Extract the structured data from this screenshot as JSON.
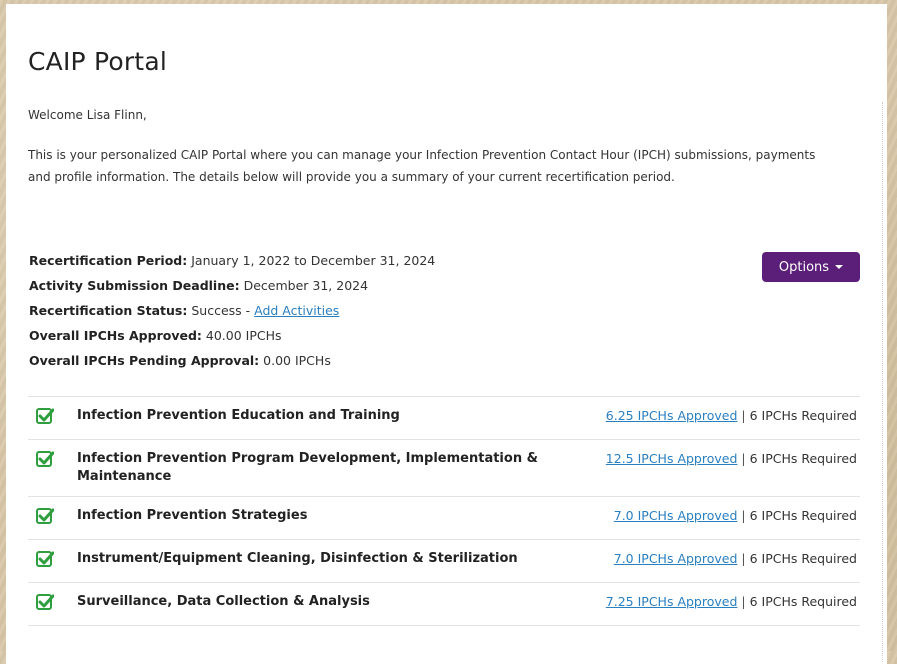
{
  "page": {
    "title": "CAIP Portal",
    "welcome": "Welcome Lisa Flinn,",
    "intro": "This is your personalized CAIP Portal where you can manage your Infection Prevention Contact Hour (IPCH) submissions, payments and profile information. The details below will provide you a summary of your current recertification period."
  },
  "summary": {
    "period_label": "Recertification Period:",
    "period_value": "January 1, 2022 to December 31, 2024",
    "deadline_label": "Activity Submission Deadline:",
    "deadline_value": "December 31, 2024",
    "status_label": "Recertification Status:",
    "status_value": "Success - ",
    "status_link": "Add Activities",
    "approved_label": "Overall IPCHs Approved:",
    "approved_value": "40.00 IPCHs",
    "pending_label": "Overall IPCHs Pending Approval:",
    "pending_value": "0.00 IPCHs"
  },
  "options_button": {
    "label": "Options"
  },
  "categories": [
    {
      "name": "Infection Prevention Education and Training",
      "approved": "6.25 IPCHs Approved",
      "separator": "|",
      "required": "6 IPCHs Required"
    },
    {
      "name": "Infection Prevention Program Development, Implementation & Maintenance",
      "approved": "12.5 IPCHs Approved",
      "separator": "|",
      "required": "6 IPCHs Required"
    },
    {
      "name": "Infection Prevention Strategies",
      "approved": "7.0 IPCHs Approved",
      "separator": "|",
      "required": "6 IPCHs Required"
    },
    {
      "name": "Instrument/Equipment Cleaning, Disinfection & Sterilization",
      "approved": "7.0 IPCHs Approved",
      "separator": "|",
      "required": "6 IPCHs Required"
    },
    {
      "name": "Surveillance, Data Collection & Analysis",
      "approved": "7.25 IPCHs Approved",
      "separator": "|",
      "required": "6 IPCHs Required"
    }
  ],
  "colors": {
    "accent_purple": "#5b1f7a",
    "check_green": "#2e9e3e",
    "link_blue": "#2a7fc0"
  },
  "icons": {
    "category_status": "checkbox-checked-icon",
    "dropdown": "caret-down-icon"
  }
}
